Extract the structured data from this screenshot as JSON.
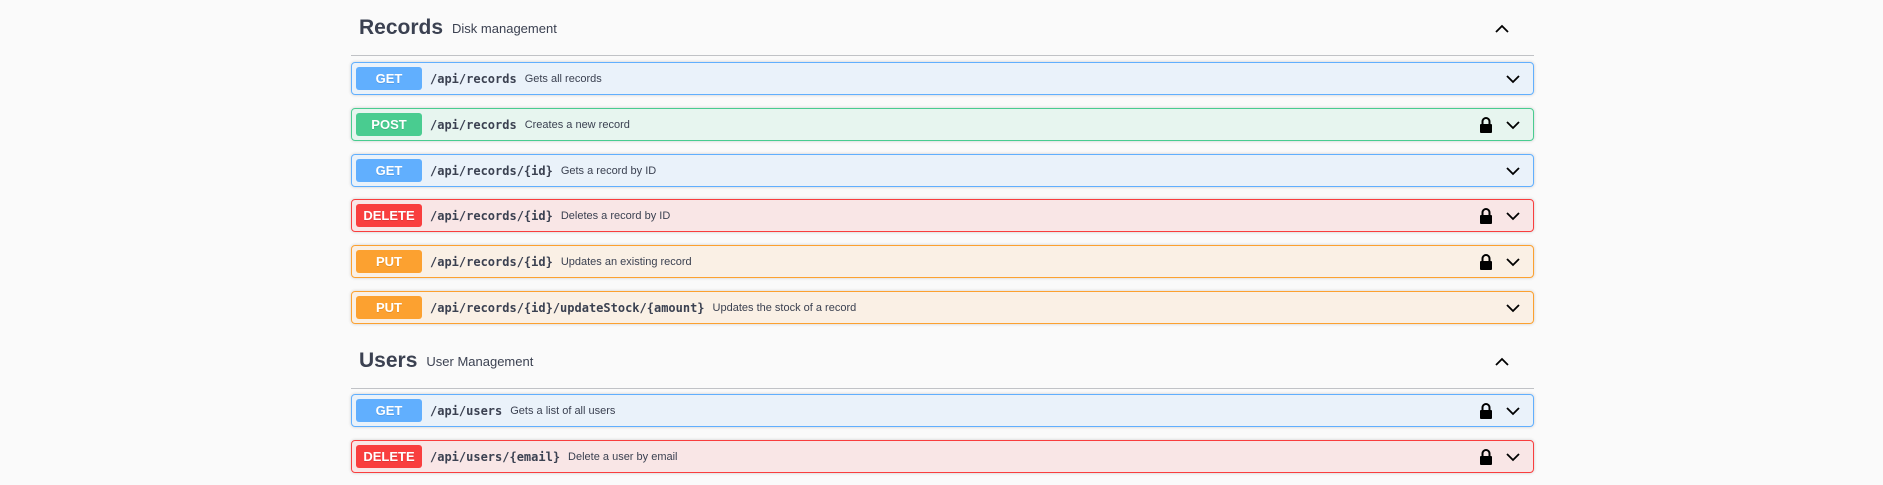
{
  "sections": [
    {
      "title": "Records",
      "description": "Disk management",
      "operations": [
        {
          "method": "GET",
          "path": "/api/records",
          "summary": "Gets all records",
          "locked": false
        },
        {
          "method": "POST",
          "path": "/api/records",
          "summary": "Creates a new record",
          "locked": true
        },
        {
          "method": "GET",
          "path": "/api/records/{id}",
          "summary": "Gets a record by ID",
          "locked": false
        },
        {
          "method": "DELETE",
          "path": "/api/records/{id}",
          "summary": "Deletes a record by ID",
          "locked": true
        },
        {
          "method": "PUT",
          "path": "/api/records/{id}",
          "summary": "Updates an existing record",
          "locked": true
        },
        {
          "method": "PUT",
          "path": "/api/records/{id}/updateStock/{amount}",
          "summary": "Updates the stock of a record",
          "locked": false
        }
      ]
    },
    {
      "title": "Users",
      "description": "User Management",
      "operations": [
        {
          "method": "GET",
          "path": "/api/users",
          "summary": "Gets a list of all users",
          "locked": true
        },
        {
          "method": "DELETE",
          "path": "/api/users/{email}",
          "summary": "Delete a user by email",
          "locked": true
        }
      ]
    }
  ],
  "colors": {
    "get": "#61affe",
    "post": "#49cc90",
    "delete": "#f93e3e",
    "put": "#fca130"
  },
  "icons": {
    "collapse": "chevron-up-icon",
    "expand": "chevron-down-icon",
    "auth": "lock-icon"
  }
}
